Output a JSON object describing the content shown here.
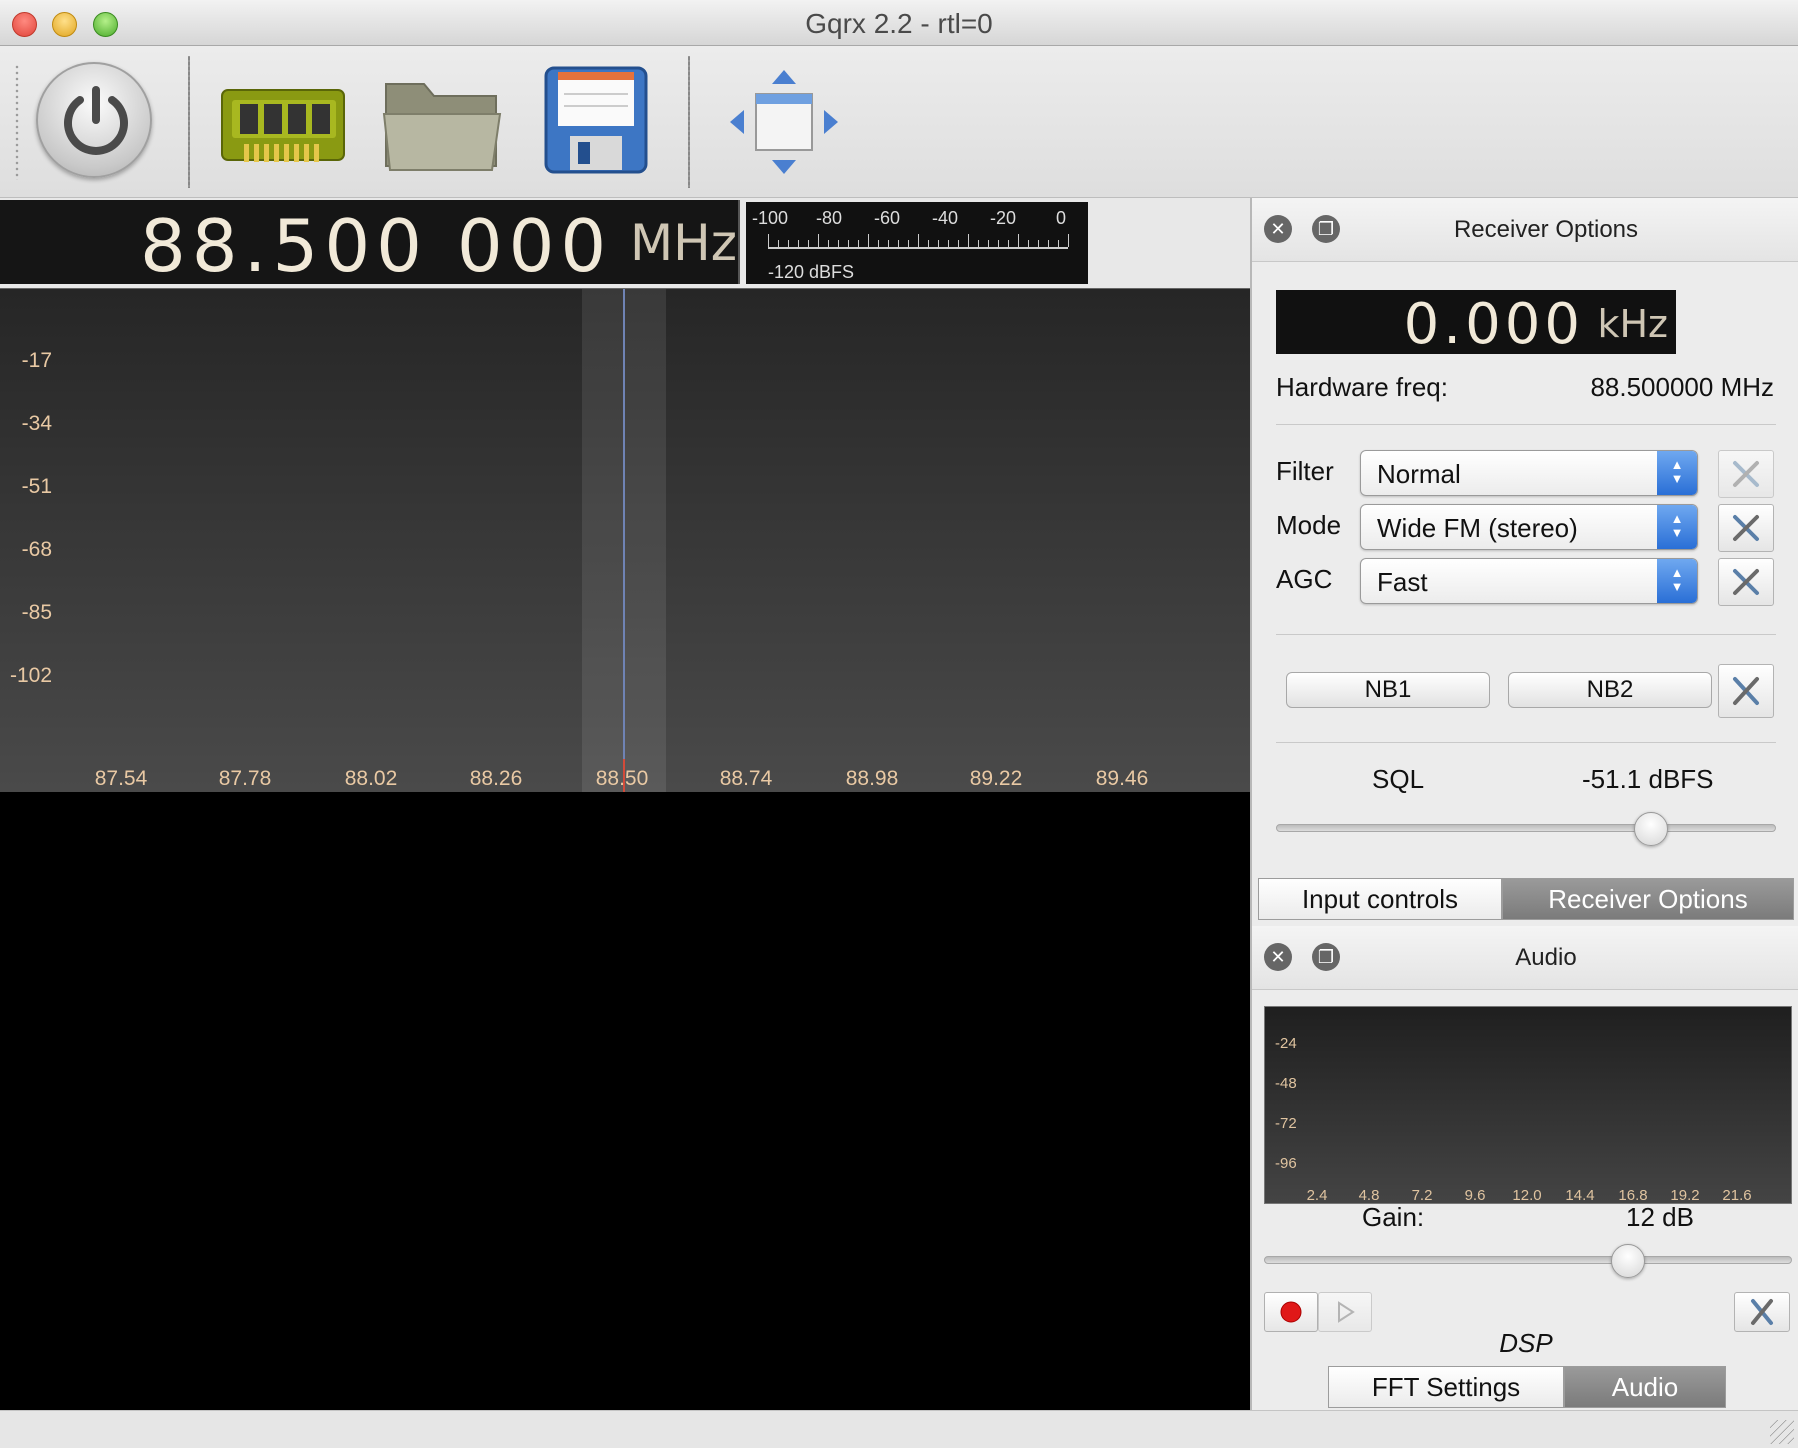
{
  "window": {
    "title": "Gqrx 2.2 - rtl=0"
  },
  "toolbar": {
    "items": [
      {
        "name": "power-icon",
        "label": "Start DSP"
      },
      {
        "name": "hardware-icon",
        "label": "I/O devices"
      },
      {
        "name": "folder-icon",
        "label": "Load settings"
      },
      {
        "name": "save-icon",
        "label": "Save settings"
      },
      {
        "name": "dock-arrows-icon",
        "label": "Toggle panels"
      }
    ]
  },
  "frequency": {
    "digits": "88.500 000",
    "unit": "MHz"
  },
  "signal_meter": {
    "scale_labels": [
      "-100",
      "-80",
      "-60",
      "-40",
      "-20",
      "0"
    ],
    "floor_label": "-120 dBFS"
  },
  "spectrum": {
    "y_labels": [
      "-17",
      "-34",
      "-51",
      "-68",
      "-85",
      "-102"
    ],
    "x_labels": [
      "87.54",
      "87.78",
      "88.02",
      "88.26",
      "88.50",
      "88.74",
      "88.98",
      "89.22",
      "89.46"
    ],
    "colors": {
      "label": "#e9c9a4",
      "center_line": "#6f83b4",
      "center_marker": "#d24b3a"
    }
  },
  "receiver_options": {
    "title": "Receiver Options",
    "offset": {
      "digits": "0.000",
      "unit": "kHz"
    },
    "hardware_freq_label": "Hardware freq:",
    "hardware_freq_value": "88.500000 MHz",
    "filter": {
      "label": "Filter",
      "value": "Normal"
    },
    "mode": {
      "label": "Mode",
      "value": "Wide FM (stereo)"
    },
    "agc": {
      "label": "AGC",
      "value": "Fast"
    },
    "nb1_label": "NB1",
    "nb2_label": "NB2",
    "sql_label": "SQL",
    "sql_value": "-51.1 dBFS",
    "sql_slider_level": 0.75
  },
  "upper_tabs": [
    {
      "label": "Input controls",
      "active": false
    },
    {
      "label": "Receiver Options",
      "active": true
    }
  ],
  "audio": {
    "title": "Audio",
    "fft_y_labels": [
      "-24",
      "-48",
      "-72",
      "-96"
    ],
    "fft_x_labels": [
      "2.4",
      "4.8",
      "7.2",
      "9.6",
      "12.0",
      "14.4",
      "16.8",
      "19.2",
      "21.6"
    ],
    "gain_label": "Gain:",
    "gain_value": "12 dB",
    "gain_slider_level": 0.69,
    "dsp_label": "DSP"
  },
  "lower_tabs": [
    {
      "label": "FFT Settings",
      "active": false
    },
    {
      "label": "Audio",
      "active": true
    }
  ]
}
